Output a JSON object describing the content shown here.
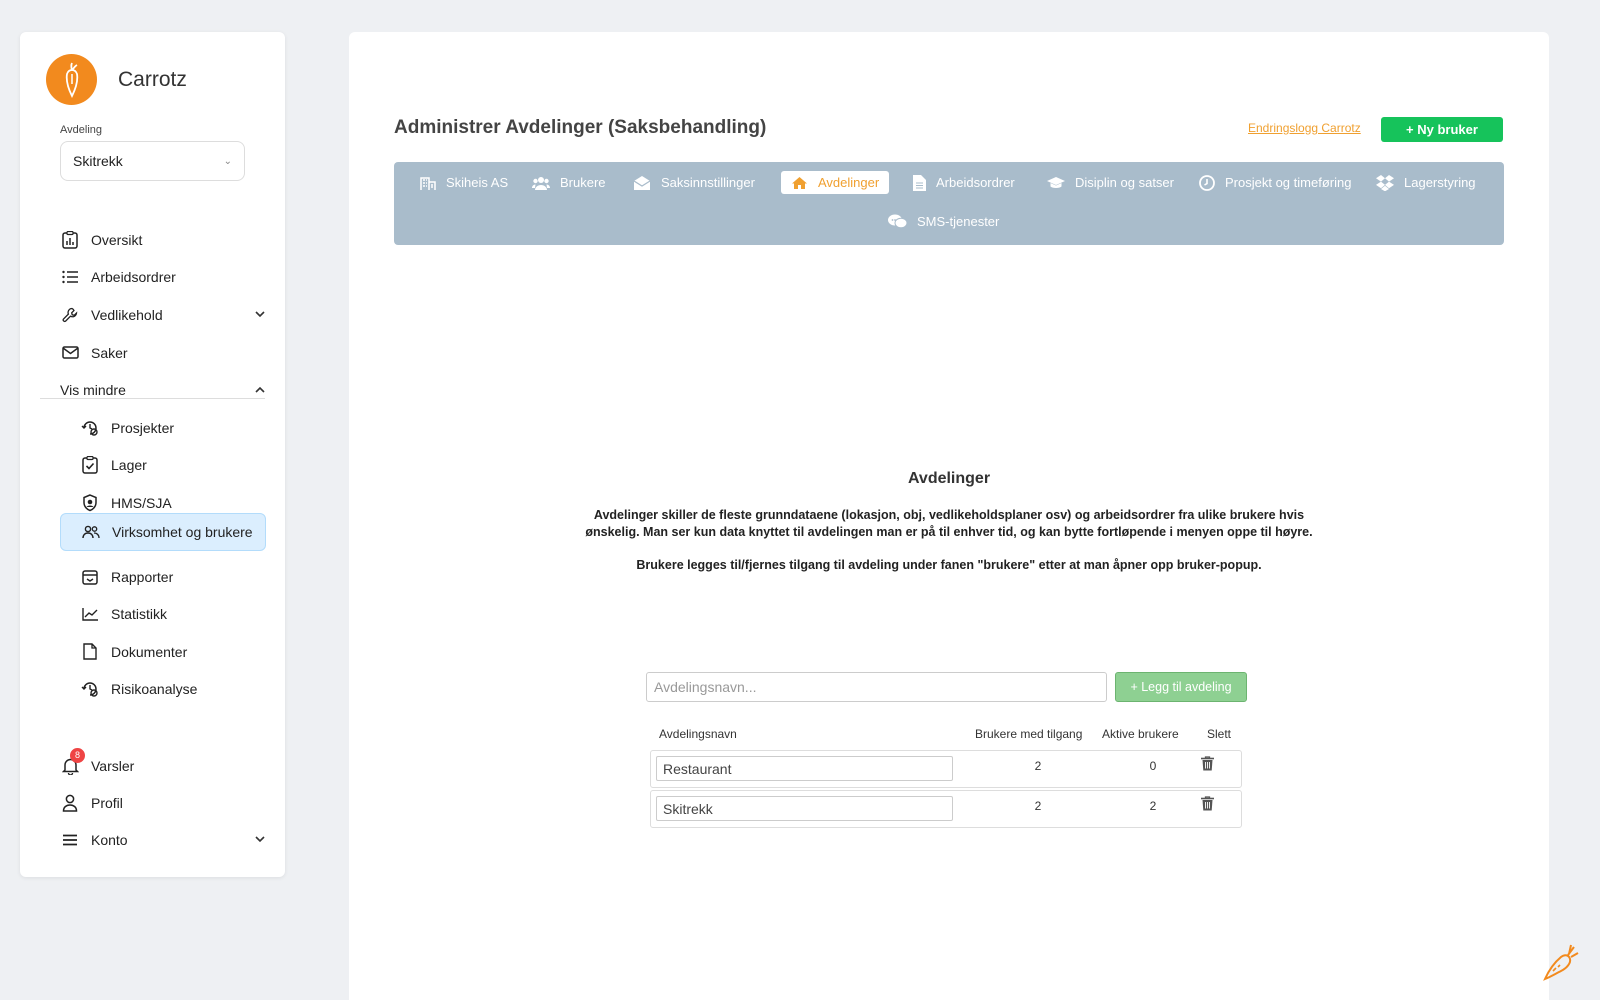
{
  "brand": {
    "name": "Carrotz",
    "color": "#f28a1e"
  },
  "department": {
    "label": "Avdeling",
    "selected": "Skitrekk"
  },
  "sidebar": {
    "items": [
      {
        "label": "Oversikt",
        "icon": "clipboard-chart-icon"
      },
      {
        "label": "Arbeidsordrer",
        "icon": "list-icon"
      },
      {
        "label": "Vedlikehold",
        "icon": "wrench-icon",
        "expandable": true
      },
      {
        "label": "Saker",
        "icon": "mail-icon"
      },
      {
        "label": "Vis mindre",
        "icon": "chevron-up-icon"
      },
      {
        "label": "Prosjekter",
        "icon": "project-icon"
      },
      {
        "label": "Lager",
        "icon": "clipboard-check-icon"
      },
      {
        "label": "HMS/SJA",
        "icon": "shield-icon"
      },
      {
        "label": "Virksomhet og brukere",
        "icon": "users-icon",
        "active": true
      },
      {
        "label": "Rapporter",
        "icon": "report-icon"
      },
      {
        "label": "Statistikk",
        "icon": "chart-line-icon"
      },
      {
        "label": "Dokumenter",
        "icon": "document-icon"
      },
      {
        "label": "Risikoanalyse",
        "icon": "risk-icon"
      },
      {
        "label": "Varsler",
        "icon": "bell-icon",
        "badge": "8"
      },
      {
        "label": "Profil",
        "icon": "user-icon"
      },
      {
        "label": "Konto",
        "icon": "menu-icon",
        "expandable": true
      }
    ]
  },
  "header": {
    "title": "Administrer Avdelinger (Saksbehandling)",
    "log_link": "Endringslogg Carrotz",
    "new_user": "+ Ny bruker"
  },
  "tabs": [
    {
      "label": "Skiheis AS",
      "icon": "building-icon"
    },
    {
      "label": "Brukere",
      "icon": "users-icon"
    },
    {
      "label": "Saksinnstillinger",
      "icon": "envelope-open-icon"
    },
    {
      "label": "Avdelinger",
      "icon": "home-icon",
      "active": true
    },
    {
      "label": "Arbeidsordrer",
      "icon": "file-icon"
    },
    {
      "label": "Disiplin og satser",
      "icon": "graduation-cap-icon"
    },
    {
      "label": "Prosjekt og timeføring",
      "icon": "clock-icon"
    },
    {
      "label": "Lagerstyring",
      "icon": "dropbox-icon"
    },
    {
      "label": "SMS-tjenester",
      "icon": "chat-icon"
    }
  ],
  "section": {
    "title": "Avdelinger",
    "desc_line1": "Avdelinger skiller de fleste grunndataene (lokasjon, obj, vedlikeholdsplaner osv) og arbeidsordrer fra ulike brukere hvis ønskelig. Man ser kun data knyttet til avdelingen man er på til enhver tid, og kan bytte fortløpende i menyen oppe til høyre.",
    "desc_line2": "Brukere legges til/fjernes tilgang til avdeling under fanen \"brukere\" etter at man åpner opp bruker-popup."
  },
  "form": {
    "placeholder": "Avdelingsnavn...",
    "add_label": "+ Legg til avdeling"
  },
  "table": {
    "headers": [
      "Avdelingsnavn",
      "Brukere med tilgang",
      "Aktive brukere",
      "Slett"
    ],
    "rows": [
      {
        "name": "Restaurant",
        "access": "2",
        "active": "0"
      },
      {
        "name": "Skitrekk",
        "access": "2",
        "active": "2"
      }
    ]
  },
  "colors": {
    "accent": "#f0a030",
    "primary_green": "#16c35b",
    "tab_bar": "#a9bccb",
    "active_nav": "#dbeefe"
  }
}
